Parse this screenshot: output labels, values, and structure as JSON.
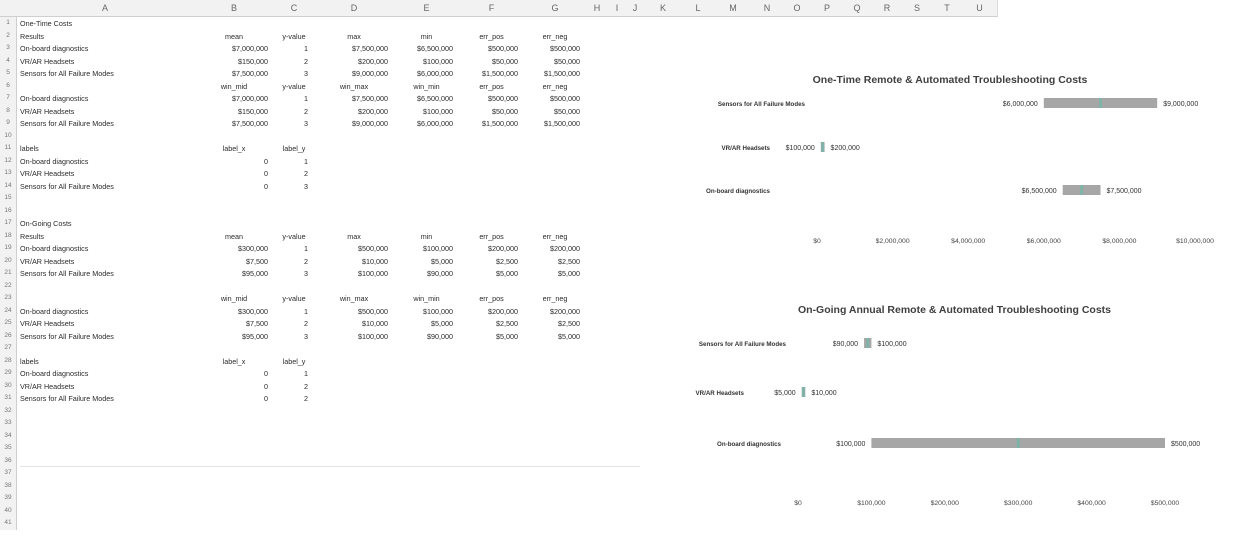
{
  "columns": [
    "A",
    "B",
    "C",
    "D",
    "E",
    "F",
    "G",
    "H",
    "I",
    "J",
    "K",
    "L",
    "M",
    "N",
    "O",
    "P",
    "Q",
    "R",
    "S",
    "T",
    "U"
  ],
  "rows": [
    [
      "One-Time Costs",
      "",
      "",
      "",
      "",
      "",
      ""
    ],
    [
      "Results",
      "mean",
      "y-value",
      "max",
      "min",
      "err_pos",
      "err_neg"
    ],
    [
      "On-board diagnostics",
      "$7,000,000",
      "1",
      "$7,500,000",
      "$6,500,000",
      "$500,000",
      "$500,000"
    ],
    [
      "VR/AR Headsets",
      "$150,000",
      "2",
      "$200,000",
      "$100,000",
      "$50,000",
      "$50,000"
    ],
    [
      "Sensors for All Failure Modes",
      "$7,500,000",
      "3",
      "$9,000,000",
      "$6,000,000",
      "$1,500,000",
      "$1,500,000"
    ],
    [
      "",
      "win_mid",
      "y-value",
      "win_max",
      "win_min",
      "err_pos",
      "err_neg"
    ],
    [
      "On-board diagnostics",
      "$7,000,000",
      "1",
      "$7,500,000",
      "$6,500,000",
      "$500,000",
      "$500,000"
    ],
    [
      "VR/AR Headsets",
      "$150,000",
      "2",
      "$200,000",
      "$100,000",
      "$50,000",
      "$50,000"
    ],
    [
      "Sensors for All Failure Modes",
      "$7,500,000",
      "3",
      "$9,000,000",
      "$6,000,000",
      "$1,500,000",
      "$1,500,000"
    ],
    [
      "",
      "",
      "",
      "",
      "",
      "",
      ""
    ],
    [
      "labels",
      "label_x",
      "label_y",
      "",
      "",
      "",
      ""
    ],
    [
      "On-board diagnostics",
      "0",
      "1",
      "",
      "",
      "",
      ""
    ],
    [
      "VR/AR Headsets",
      "0",
      "2",
      "",
      "",
      "",
      ""
    ],
    [
      "Sensors for All Failure Modes",
      "0",
      "3",
      "",
      "",
      "",
      ""
    ],
    [
      "",
      "",
      "",
      "",
      "",
      "",
      ""
    ],
    [
      "",
      "",
      "",
      "",
      "",
      "",
      ""
    ],
    [
      "On-Going Costs",
      "",
      "",
      "",
      "",
      "",
      ""
    ],
    [
      "Results",
      "mean",
      "y-value",
      "max",
      "min",
      "err_pos",
      "err_neg"
    ],
    [
      "On-board diagnostics",
      "$300,000",
      "1",
      "$500,000",
      "$100,000",
      "$200,000",
      "$200,000"
    ],
    [
      "VR/AR Headsets",
      "$7,500",
      "2",
      "$10,000",
      "$5,000",
      "$2,500",
      "$2,500"
    ],
    [
      "Sensors for All Failure Modes",
      "$95,000",
      "3",
      "$100,000",
      "$90,000",
      "$5,000",
      "$5,000"
    ],
    [
      "",
      "",
      "",
      "",
      "",
      "",
      ""
    ],
    [
      "",
      "win_mid",
      "y-value",
      "win_max",
      "win_min",
      "err_pos",
      "err_neg"
    ],
    [
      "On-board diagnostics",
      "$300,000",
      "1",
      "$500,000",
      "$100,000",
      "$200,000",
      "$200,000"
    ],
    [
      "VR/AR Headsets",
      "$7,500",
      "2",
      "$10,000",
      "$5,000",
      "$2,500",
      "$2,500"
    ],
    [
      "Sensors for All Failure Modes",
      "$95,000",
      "3",
      "$100,000",
      "$90,000",
      "$5,000",
      "$5,000"
    ],
    [
      "",
      "",
      "",
      "",
      "",
      "",
      ""
    ],
    [
      "labels",
      "label_x",
      "label_y",
      "",
      "",
      "",
      ""
    ],
    [
      "On-board diagnostics",
      "0",
      "1",
      "",
      "",
      "",
      ""
    ],
    [
      "VR/AR Headsets",
      "0",
      "2",
      "",
      "",
      "",
      ""
    ],
    [
      "Sensors for All Failure Modes",
      "0",
      "2",
      "",
      "",
      "",
      ""
    ],
    [
      "",
      "",
      "",
      "",
      "",
      "",
      ""
    ],
    [
      "",
      "",
      "",
      "",
      "",
      "",
      ""
    ],
    [
      "",
      "",
      "",
      "",
      "",
      "",
      ""
    ],
    [
      "",
      "",
      "",
      "",
      "",
      "",
      ""
    ],
    [
      "",
      "",
      "",
      "",
      "",
      "",
      ""
    ],
    [
      "",
      "",
      "",
      "",
      "",
      "",
      ""
    ],
    [
      "",
      "",
      "",
      "",
      "",
      "",
      ""
    ],
    [
      "",
      "",
      "",
      "",
      "",
      "",
      ""
    ],
    [
      "",
      "",
      "",
      "",
      "",
      "",
      ""
    ],
    [
      "",
      "",
      "",
      "",
      "",
      "",
      ""
    ]
  ],
  "charts": [
    {
      "title": "One-Time Remote & Automated Troubleshooting Costs",
      "categories": [
        "On-board diagnostics",
        "VR/AR Headsets",
        "Sensors for All Failure Modes"
      ],
      "min": [
        6500000,
        100000,
        6000000
      ],
      "max": [
        7500000,
        200000,
        9000000
      ],
      "mid": [
        7000000,
        150000,
        7500000
      ],
      "min_labels": [
        "$6,500,000",
        "$100,000",
        "$6,000,000"
      ],
      "max_labels": [
        "$7,500,000",
        "$200,000",
        "$9,000,000"
      ],
      "xlim": [
        0,
        10000000
      ],
      "ticks": [
        0,
        2000000,
        4000000,
        6000000,
        8000000,
        10000000
      ],
      "tick_labels": [
        "$0",
        "$2,000,000",
        "$4,000,000",
        "$6,000,000",
        "$8,000,000",
        "$10,000,000"
      ],
      "bar_color": "#a6a6a6",
      "mid_color": "#7fb3a8"
    },
    {
      "title": "On-Going Annual Remote & Automated Troubleshooting Costs",
      "categories": [
        "On-board diagnostics",
        "VR/AR Headsets",
        "Sensors for All Failure Modes"
      ],
      "min": [
        100000,
        5000,
        90000
      ],
      "max": [
        500000,
        10000,
        100000
      ],
      "mid": [
        300000,
        7500,
        95000
      ],
      "min_labels": [
        "$100,000",
        "$5,000",
        "$90,000"
      ],
      "max_labels": [
        "$500,000",
        "$10,000",
        "$100,000"
      ],
      "xlim": [
        0,
        500000
      ],
      "ticks": [
        0,
        100000,
        200000,
        300000,
        400000,
        500000
      ],
      "tick_labels": [
        "$0",
        "$100,000",
        "$200,000",
        "$300,000",
        "$400,000",
        "$500,000"
      ],
      "bar_color": "#a6a6a6",
      "mid_color": "#7fb3a8"
    }
  ],
  "chart_data": [
    {
      "type": "bar",
      "title": "One-Time Remote & Automated Troubleshooting Costs",
      "categories": [
        "On-board diagnostics",
        "VR/AR Headsets",
        "Sensors for All Failure Modes"
      ],
      "series": [
        {
          "name": "min",
          "values": [
            6500000,
            100000,
            6000000
          ]
        },
        {
          "name": "max",
          "values": [
            7500000,
            200000,
            9000000
          ]
        }
      ],
      "xlim": [
        0,
        10000000
      ]
    },
    {
      "type": "bar",
      "title": "On-Going Annual Remote & Automated Troubleshooting Costs",
      "categories": [
        "On-board diagnostics",
        "VR/AR Headsets",
        "Sensors for All Failure Modes"
      ],
      "series": [
        {
          "name": "min",
          "values": [
            100000,
            5000,
            90000
          ]
        },
        {
          "name": "max",
          "values": [
            500000,
            10000,
            100000
          ]
        }
      ],
      "xlim": [
        0,
        500000
      ]
    }
  ]
}
